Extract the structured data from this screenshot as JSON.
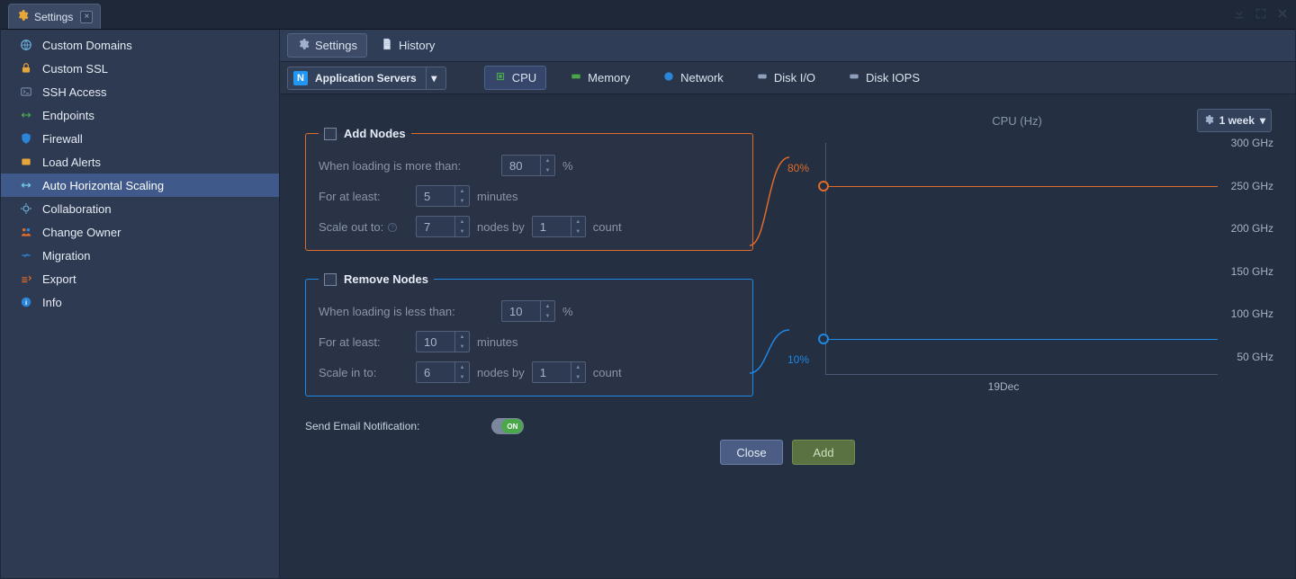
{
  "titlebar": {
    "tab_label": "Settings"
  },
  "sidebar": {
    "items": [
      {
        "label": "Custom Domains"
      },
      {
        "label": "Custom SSL"
      },
      {
        "label": "SSH Access"
      },
      {
        "label": "Endpoints"
      },
      {
        "label": "Firewall"
      },
      {
        "label": "Load Alerts"
      },
      {
        "label": "Auto Horizontal Scaling"
      },
      {
        "label": "Collaboration"
      },
      {
        "label": "Change Owner"
      },
      {
        "label": "Migration"
      },
      {
        "label": "Export"
      },
      {
        "label": "Info"
      }
    ],
    "selected_index": 6
  },
  "toolbar": {
    "tabs": {
      "settings": "Settings",
      "history": "History"
    },
    "active": "settings"
  },
  "subtoolbar": {
    "servers_dropdown": "Application Servers",
    "metrics": {
      "cpu": "CPU",
      "memory": "Memory",
      "network": "Network",
      "diskio": "Disk I/O",
      "diskiops": "Disk IOPS"
    },
    "active_metric": "cpu"
  },
  "rules": {
    "add": {
      "title": "Add Nodes",
      "load_more_than_label": "When loading is more than:",
      "load_more_than_value": "80",
      "percent": "%",
      "for_at_least_label": "For at least:",
      "for_at_least_value": "5",
      "minutes": "minutes",
      "scale_out_label": "Scale out to:",
      "scale_out_value": "7",
      "nodes_by": "nodes by",
      "count_step": "1",
      "count": "count"
    },
    "remove": {
      "title": "Remove Nodes",
      "load_less_than_label": "When loading is less than:",
      "load_less_than_value": "10",
      "percent": "%",
      "for_at_least_label": "For at least:",
      "for_at_least_value": "10",
      "minutes": "minutes",
      "scale_in_label": "Scale in to:",
      "scale_in_value": "6",
      "nodes_by": "nodes by",
      "count_step": "1",
      "count": "count"
    }
  },
  "notification": {
    "label": "Send Email Notification:",
    "state": "ON"
  },
  "buttons": {
    "close": "Close",
    "add": "Add"
  },
  "chart": {
    "title": "CPU (Hz)",
    "range_label": "1 week",
    "thresholds": {
      "hi_label": "80%",
      "lo_label": "10%"
    }
  },
  "chart_data": {
    "type": "line",
    "title": "CPU (Hz)",
    "xlabel": "",
    "ylabel": "",
    "ylim": [
      0,
      300
    ],
    "yunit": "GHz",
    "yticks": [
      50,
      100,
      150,
      200,
      250,
      300
    ],
    "ytick_labels": [
      "50 GHz",
      "100 GHz",
      "150 GHz",
      "200 GHz",
      "250 GHz",
      "300 GHz"
    ],
    "xticks": [
      "19Dec"
    ],
    "time_range": "1 week",
    "thresholds": [
      {
        "name": "Add Nodes",
        "percent": 80,
        "value_ghz": 250,
        "color": "#e06b2a"
      },
      {
        "name": "Remove Nodes",
        "percent": 10,
        "value_ghz": 40,
        "color": "#1e88e5"
      }
    ],
    "series": []
  }
}
